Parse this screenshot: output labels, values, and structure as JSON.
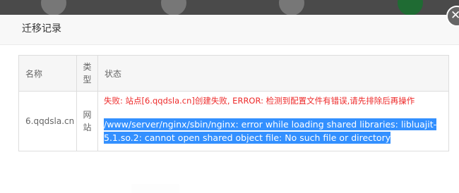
{
  "modal": {
    "title": "迁移记录",
    "close_icon": "close-icon"
  },
  "table": {
    "headers": [
      "名称",
      "类型",
      "状态"
    ],
    "rows": [
      {
        "name": "6.qqdsla.cn",
        "type": "网站",
        "error": "失败: 站点[6.qqdsla.cn]创建失败, ERROR: 检测到配置文件有错误,请先排除后再操作",
        "detail": "/www/server/nginx/sbin/nginx: error while loading shared libraries: libluajit-5.1.so.2: cannot open shared object file: No such file or directory"
      }
    ]
  },
  "colors": {
    "error": "#ee2a2a",
    "selection": "#3390ff",
    "overlay": "#4a4a4a"
  }
}
